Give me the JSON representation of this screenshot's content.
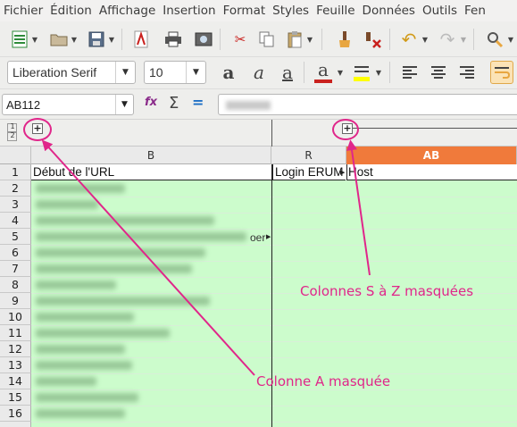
{
  "menubar": {
    "items": [
      "Fichier",
      "Édition",
      "Affichage",
      "Insertion",
      "Format",
      "Styles",
      "Feuille",
      "Données",
      "Outils",
      "Fen"
    ]
  },
  "toolbar_format": {
    "font_name": "Liberation Serif",
    "font_size": "10",
    "bold_label": "a",
    "italic_label": "a",
    "underline_label": "a",
    "font_color_label": "a",
    "font_color": "#c9211e",
    "highlight_color": "#ffff00"
  },
  "formula_bar": {
    "name_box": "AB112",
    "fx": "fx",
    "sum": "Σ",
    "equals": "="
  },
  "outline": {
    "level1": "1",
    "level2": "2",
    "expand_label": "+"
  },
  "columns": {
    "b": "B",
    "r": "R",
    "ab": "AB"
  },
  "rows": [
    "1",
    "2",
    "3",
    "4",
    "5",
    "6",
    "7",
    "8",
    "9",
    "10",
    "11",
    "12",
    "13",
    "14",
    "15",
    "16"
  ],
  "header_row": {
    "b": "Début de l'URL",
    "r": "Login ERUM",
    "ab": "Host"
  },
  "row5_overflow_text": "oer",
  "annotations": {
    "hidden_a": "Colonne A masquée",
    "hidden_s_z": "Colonnes S à Z masquées",
    "color": "#e0268a"
  },
  "colors": {
    "cell_background": "#ccfccc",
    "selected_column": "#f07a3b"
  }
}
